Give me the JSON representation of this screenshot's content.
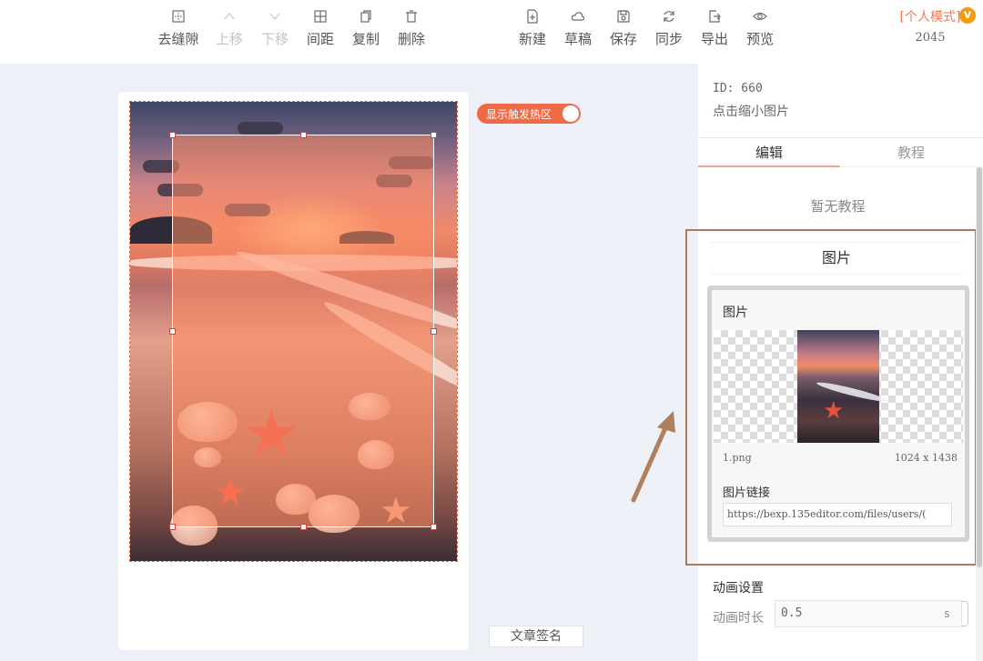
{
  "toolbar": {
    "items": [
      {
        "label": "去缝隙",
        "icon": "gap-icon",
        "disabled": false
      },
      {
        "label": "上移",
        "icon": "chevron-up-icon",
        "disabled": true
      },
      {
        "label": "下移",
        "icon": "chevron-down-icon",
        "disabled": true
      },
      {
        "label": "间距",
        "icon": "spacing-icon",
        "disabled": false
      },
      {
        "label": "复制",
        "icon": "copy-icon",
        "disabled": false
      },
      {
        "label": "删除",
        "icon": "trash-icon",
        "disabled": false
      },
      {
        "label": "新建",
        "icon": "new-file-icon",
        "disabled": false
      },
      {
        "label": "草稿",
        "icon": "cloud-icon",
        "disabled": false
      },
      {
        "label": "保存",
        "icon": "save-icon",
        "disabled": false
      },
      {
        "label": "同步",
        "icon": "sync-icon",
        "disabled": false
      },
      {
        "label": "导出",
        "icon": "export-icon",
        "disabled": false
      },
      {
        "label": "预览",
        "icon": "eye-icon",
        "disabled": false
      }
    ],
    "mode_label": "[个人模式]",
    "mode_year": "2045",
    "badge": "v"
  },
  "canvas": {
    "hotzone_toggle_label": "显示触发热区",
    "hotzone_enabled": true,
    "sign_button": "文章签名"
  },
  "panel": {
    "id_text": "ID: 660",
    "hint": "点击缩小图片",
    "tabs": [
      "编辑",
      "教程"
    ],
    "active_tab": "编辑",
    "no_tutorial": "暂无教程",
    "section_title": "图片",
    "image": {
      "label": "图片",
      "file_name": "1.png",
      "dimensions": "1024 x 1438",
      "link_label": "图片链接",
      "link_value": "https://bexp.135editor.com/files/users/("
    },
    "animation": {
      "title": "动画设置",
      "duration_label": "动画时长",
      "duration_value": "0.5",
      "unit": "s"
    }
  },
  "colors": {
    "accent": "#f06a45",
    "highlight_border": "#b07a5a"
  }
}
